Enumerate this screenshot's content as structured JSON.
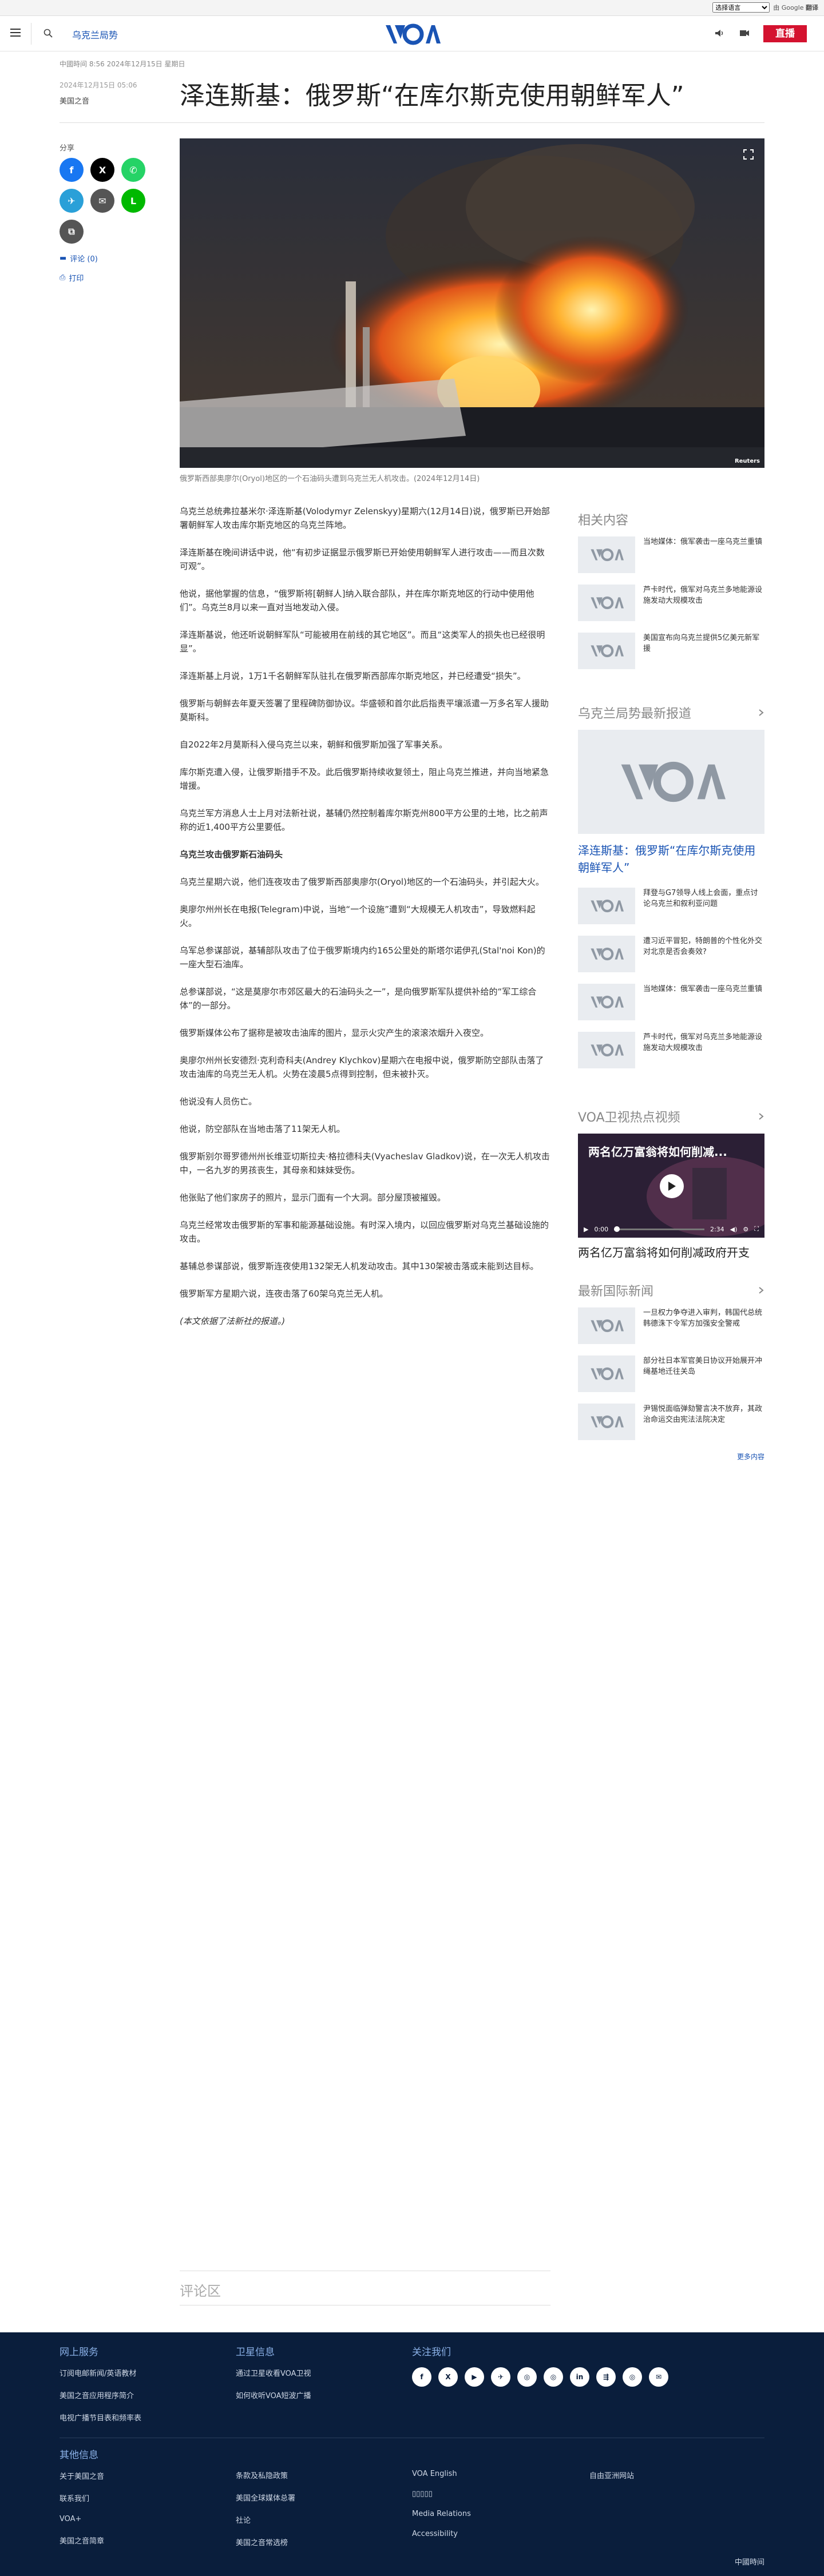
{
  "translate": {
    "select_label": "选择语言",
    "brand": "Google",
    "brand_suffix": "翻译",
    "powered": "由"
  },
  "header": {
    "section": "乌克兰局势",
    "live_label": "直播",
    "logo_text": "VOA"
  },
  "article": {
    "meta": "中國時间 8:56 2024年12月15日 星期日",
    "date": "2024年12月15日 05:06",
    "author": "美国之音",
    "title": "泽连斯基：俄罗斯“在库尔斯克使用朝鲜军人”",
    "share_label": "分享",
    "comments_label": "评论 (0)",
    "print_label": "打印",
    "caption": "俄罗斯西部奥廖尔(Oryol)地区的一个石油码头遭到乌克兰无人机攻击。(2024年12月14日)",
    "reuters": "Reuters",
    "paragraphs": [
      {
        "t": "乌克兰总统弗拉基米尔·泽连斯基(Volodymyr Zelenskyy)星期六(12月14日)说，俄罗斯已开始部署朝鲜军人攻击库尔斯克地区的乌克兰阵地。",
        "s": "n"
      },
      {
        "t": "泽连斯基在晚间讲话中说，他“有初步证据显示俄罗斯已开始使用朝鲜军人进行攻击——而且次数可观”。",
        "s": "n"
      },
      {
        "t": "他说，据他掌握的信息，“俄罗斯将[朝鲜人]纳入联合部队，并在库尔斯克地区的行动中使用他们”。乌克兰8月以来一直对当地发动入侵。",
        "s": "n"
      },
      {
        "t": "泽连斯基说，他还听说朝鲜军队“可能被用在前线的其它地区”。而且“这类军人的损失也已经很明显”。",
        "s": "n"
      },
      {
        "t": "泽连斯基上月说，1万1千名朝鲜军队驻扎在俄罗斯西部库尔斯克地区，并已经遭受“损失”。",
        "s": "n"
      },
      {
        "t": "俄罗斯与朝鲜去年夏天签署了里程碑防御协议。华盛顿和首尔此后指责平壤派遣一万多名军人援助莫斯科。",
        "s": "n"
      },
      {
        "t": "自2022年2月莫斯科入侵乌克兰以来，朝鲜和俄罗斯加强了军事关系。",
        "s": "n"
      },
      {
        "t": "库尔斯克遭入侵，让俄罗斯措手不及。此后俄罗斯持续收复领土，阻止乌克兰推进，并向当地紧急增援。",
        "s": "n"
      },
      {
        "t": "乌克兰军方消息人士上月对法新社说，基辅仍然控制着库尔斯克州800平方公里的土地，比之前声称的近1,400平方公里要低。",
        "s": "n"
      },
      {
        "t": "乌克兰攻击俄罗斯石油码头",
        "s": "sub"
      },
      {
        "t": "乌克兰星期六说，他们连夜攻击了俄罗斯西部奥廖尔(Oryol)地区的一个石油码头，并引起大火。",
        "s": "n"
      },
      {
        "t": "奥廖尔州州长在电报(Telegram)中说，当地“一个设施”遭到“大规模无人机攻击”，导致燃料起火。",
        "s": "n"
      },
      {
        "t": "乌军总参谋部说，基辅部队攻击了位于俄罗斯境内约165公里处的斯塔尔诺伊孔(Stal'noi Kon)的一座大型石油库。",
        "s": "n"
      },
      {
        "t": "总参谋部说，“这是莫廖尔市郊区最大的石油码头之一”，是向俄罗斯军队提供补给的“军工综合体”的一部分。",
        "s": "n"
      },
      {
        "t": "俄罗斯媒体公布了据称是被攻击油库的图片，显示火灾产生的滚滚浓烟升入夜空。",
        "s": "n"
      },
      {
        "t": "奥廖尔州州长安德烈·克利奇科夫(Andrey Klychkov)星期六在电报中说，俄罗斯防空部队击落了攻击油库的乌克兰无人机。火势在凌晨5点得到控制，但未被扑灭。",
        "s": "n"
      },
      {
        "t": "他说没有人员伤亡。",
        "s": "n"
      },
      {
        "t": "他说，防空部队在当地击落了11架无人机。",
        "s": "n"
      },
      {
        "t": "俄罗斯别尔哥罗德州州长维亚切斯拉夫·格拉德科夫(Vyacheslav Gladkov)说，在一次无人机攻击中，一名九岁的男孩丧生，其母亲和妹妹受伤。",
        "s": "n"
      },
      {
        "t": "他张贴了他们家房子的照片，显示门面有一个大洞。部分屋顶被摧毁。",
        "s": "n"
      },
      {
        "t": "乌克兰经常攻击俄罗斯的军事和能源基础设施。有时深入境内，以回应俄罗斯对乌克兰基础设施的攻击。",
        "s": "n"
      },
      {
        "t": "基辅总参谋部说，俄罗斯连夜使用132架无人机发动攻击。其中130架被击落或未能到达目标。",
        "s": "n"
      },
      {
        "t": "俄罗斯军方星期六说，连夜击落了60架乌克兰无人机。",
        "s": "n"
      },
      {
        "t": "(本文依据了法新社的报道。)",
        "s": "ital"
      }
    ],
    "comments_title": "评论区"
  },
  "sidebar": {
    "related_title": "相关内容",
    "related": [
      "当地媒体：俄军袭击一座乌克兰重镇",
      "芦卡时代，俄军对乌克兰多地能源设施发动大规模攻击",
      "美国宣布向乌克兰提供5亿美元新军援"
    ],
    "latest_title": "乌克兰局势最新报道",
    "latest_feature": "泽连斯基：俄罗斯“在库尔斯克使用朝鲜军人”",
    "latest": [
      "拜登与G7领导人线上会面，重点讨论乌克兰和叙利亚问题",
      "遭习近平冒犯，特朗普的个性化外交对北京是否会奏效?",
      "当地媒体：俄军袭击一座乌克兰重镇",
      "芦卡时代，俄军对乌克兰多地能源设施发动大规模攻击"
    ],
    "video_title": "VOA卫视热点视频",
    "video_overlay": "两名亿万富翁将如何削减...",
    "video_time": "0:00",
    "video_duration": "2:34",
    "video_caption": "两名亿万富翁将如何削减政府开支",
    "news_title": "最新国际新闻",
    "news": [
      "一旦权力争夺进入审判，韩国代总统韩德洙下令军方加强安全警戒",
      "部分社日本军官美日协议开始展开冲绳基地迁往关岛",
      "尹锡悦面临弹劾警言决不放弃，其政治命运交由宪法法院决定"
    ],
    "more_label": "更多内容"
  },
  "footer": {
    "col1_head": "网上服务",
    "col1": [
      "订阅电邮新闻/英语教材",
      "美国之音应用程序简介",
      "电视广播节目表和频率表"
    ],
    "col2_head": "卫星信息",
    "col2": [
      "通过卫星收看VOA卫视",
      "如何收听VOA短波广播"
    ],
    "col3_head": "关注我们",
    "social": [
      "f",
      "X",
      "▶",
      "✈",
      "◎",
      "◎",
      "in",
      "⇶",
      "◎",
      "✉"
    ],
    "other_head": "其他信息",
    "other_col1": [
      "关于美国之音",
      "联系我们",
      "VOA+",
      "美国之音简章"
    ],
    "other_col2": [
      "条款及私隐政策",
      "美国全球媒体总署",
      "社论",
      "美国之音常选榜"
    ],
    "other_col3": [
      "VOA English",
      "▯▯▯▯▯",
      "Media Relations",
      "Accessibility"
    ],
    "other_col4": [
      "自由亚洲网站"
    ],
    "corner": "中國時间"
  }
}
